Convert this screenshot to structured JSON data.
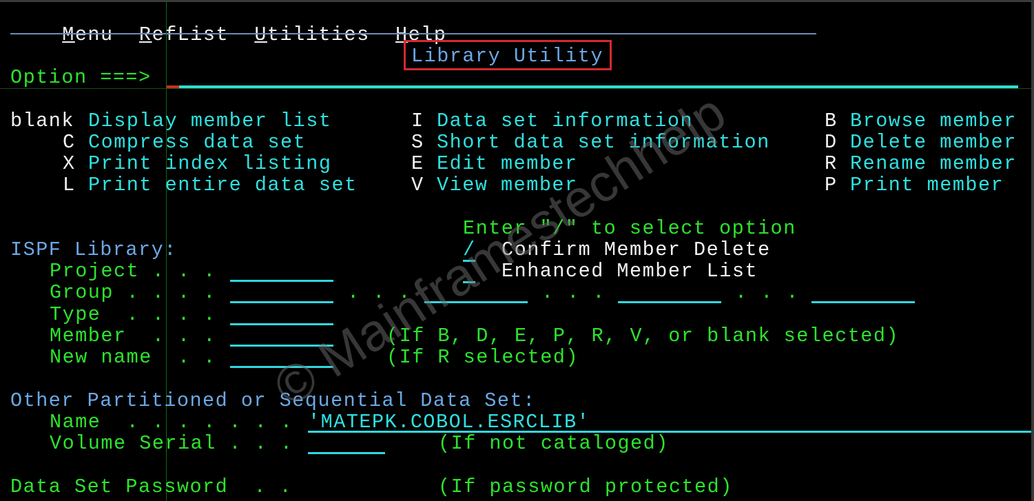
{
  "menu_bar": {
    "items": [
      {
        "accel": "M",
        "rest": "enu"
      },
      {
        "accel": "R",
        "rest": "efList"
      },
      {
        "accel": "U",
        "rest": "tilities"
      },
      {
        "accel": "H",
        "rest": "elp"
      }
    ]
  },
  "panel_title": "Library Utility",
  "command": {
    "label": "Option ===>",
    "value": ""
  },
  "options": {
    "col1": [
      {
        "key": "blank",
        "desc": "Display member list"
      },
      {
        "key": "C",
        "desc": "Compress data set"
      },
      {
        "key": "X",
        "desc": "Print index listing"
      },
      {
        "key": "L",
        "desc": "Print entire data set"
      }
    ],
    "col2": [
      {
        "key": "I",
        "desc": "Data set information"
      },
      {
        "key": "S",
        "desc": "Short data set information"
      },
      {
        "key": "E",
        "desc": "Edit member"
      },
      {
        "key": "V",
        "desc": "View member"
      }
    ],
    "col3": [
      {
        "key": "B",
        "desc": "Browse member"
      },
      {
        "key": "D",
        "desc": "Delete member"
      },
      {
        "key": "R",
        "desc": "Rename member"
      },
      {
        "key": "P",
        "desc": "Print member"
      }
    ]
  },
  "select_options": {
    "heading": "Enter \"/\" to select option",
    "items": [
      {
        "value": "/",
        "label": "Confirm Member Delete"
      },
      {
        "value": "",
        "label": "Enhanced Member List"
      }
    ]
  },
  "ispf_library": {
    "heading": "ISPF Library:",
    "project": {
      "label": "Project . . .",
      "value": ""
    },
    "group": {
      "label": "Group . . . .",
      "value": "",
      "sep": ". . .",
      "extra": [
        "",
        "",
        ""
      ]
    },
    "type": {
      "label": "Type  . . . .",
      "value": ""
    },
    "member": {
      "label": "Member  . . .",
      "value": "",
      "hint": "(If B, D, E, P, R, V, or blank selected)"
    },
    "new_name": {
      "label": "New name  . .",
      "value": "",
      "hint": "(If R selected)"
    }
  },
  "other_dataset": {
    "heading": "Other Partitioned or Sequential Data Set:",
    "name": {
      "label": "Name  . . . . . . .",
      "value": "'MATEPK.COBOL.ESRCLIB'"
    },
    "volume_serial": {
      "label": "Volume Serial . . .",
      "value": "",
      "hint": "(If not cataloged)"
    }
  },
  "password": {
    "label": "Data Set Password  . .",
    "hint": "(If password protected)"
  },
  "watermark": "© Mainframestechhelp"
}
